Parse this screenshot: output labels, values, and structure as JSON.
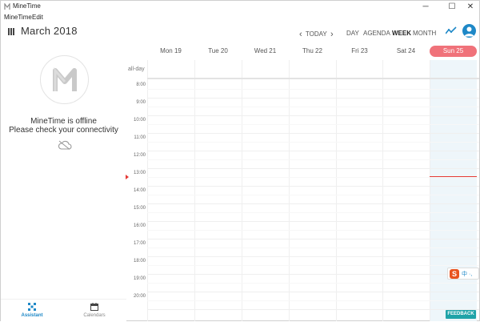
{
  "window": {
    "title": "MineTime",
    "controls": {
      "minimize": "─",
      "maximize": "☐",
      "close": "✕"
    }
  },
  "menu": {
    "items": [
      "MineTime",
      "Edit"
    ]
  },
  "header": {
    "month_title": "March 2018",
    "today_label": "TODAY",
    "prev_glyph": "‹",
    "next_glyph": "›",
    "views": [
      "DAY",
      "AGENDA",
      "WEEK",
      "MONTH"
    ],
    "active_view": "WEEK"
  },
  "sidebar": {
    "offline_title": "MineTime is offline",
    "offline_message": "Please check your connectivity",
    "tabs": [
      {
        "label": "Assistant",
        "icon": "assistant-icon",
        "active": true
      },
      {
        "label": "Calendars",
        "icon": "calendar-icon",
        "active": false
      }
    ]
  },
  "calendar": {
    "days": [
      "Mon 19",
      "Tue 20",
      "Wed 21",
      "Thu 22",
      "Fri 23",
      "Sat 24",
      "Sun 25"
    ],
    "today_index": 6,
    "allday_label": "all-day",
    "hours": [
      "8:00",
      "9:00",
      "10:00",
      "11:00",
      "12:00",
      "13:00",
      "14:00",
      "15:00",
      "16:00",
      "17:00",
      "18:00",
      "19:00",
      "20:00"
    ]
  },
  "overlay": {
    "ime_logo": "S",
    "ime_text": "中 ·,",
    "feedback_label": "FEEDBACK"
  },
  "colors": {
    "accent": "#1e88c7",
    "today_badge": "#f0727a",
    "now_line": "#e53935",
    "feedback": "#1fa3a8"
  }
}
